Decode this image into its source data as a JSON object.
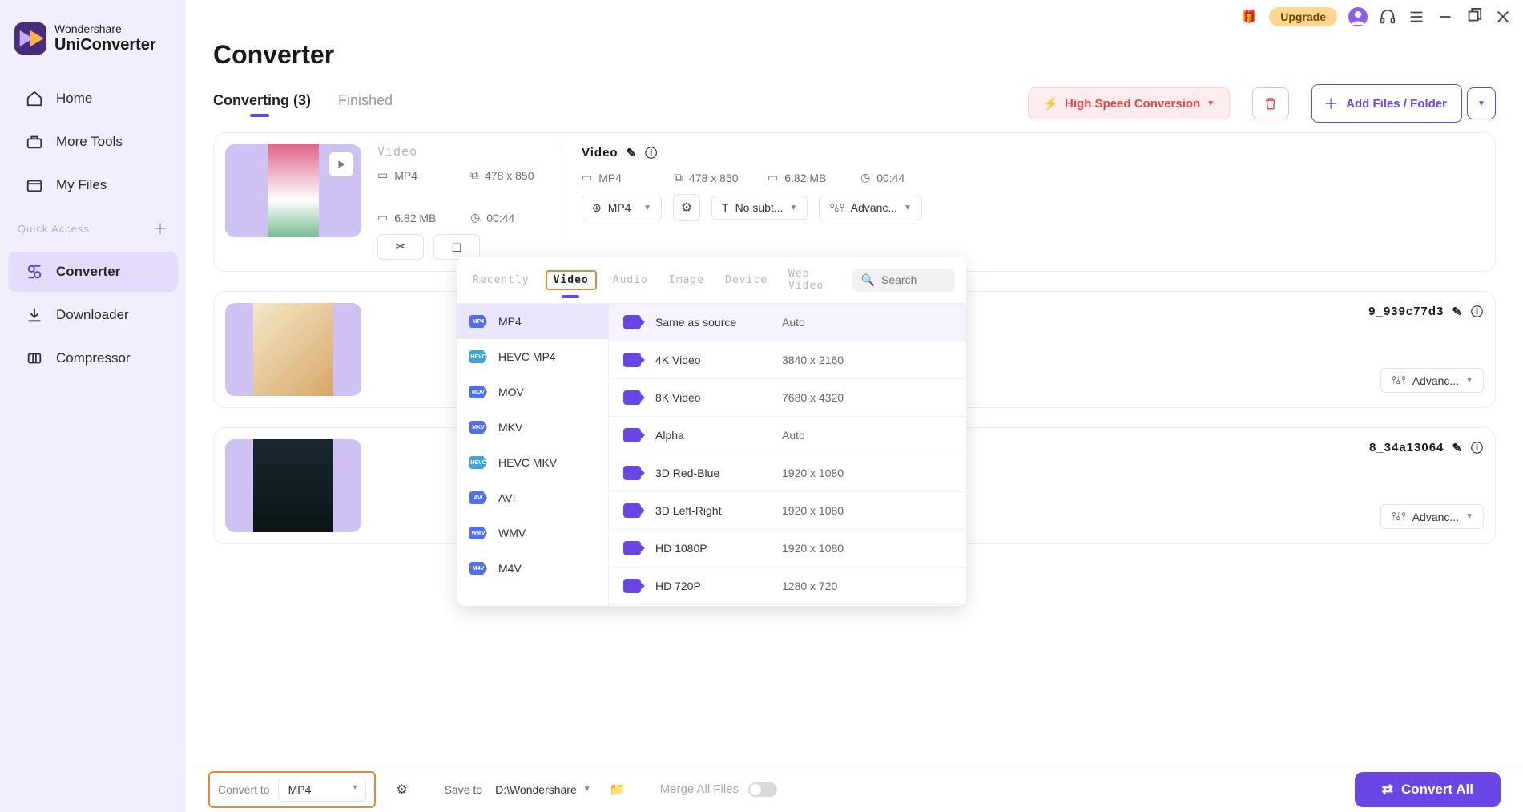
{
  "app": {
    "brand_top": "Wondershare",
    "brand_bottom": "UniConverter"
  },
  "sidebar": {
    "items": [
      {
        "label": "Home"
      },
      {
        "label": "More Tools"
      },
      {
        "label": "My Files"
      }
    ],
    "quick_access": "Quick Access",
    "items2": [
      {
        "label": "Converter"
      },
      {
        "label": "Downloader"
      },
      {
        "label": "Compressor"
      }
    ]
  },
  "titlebar": {
    "upgrade": "Upgrade"
  },
  "page": {
    "title": "Converter"
  },
  "tabs": {
    "converting": "Converting (3)",
    "finished": "Finished"
  },
  "toolbar": {
    "high_speed": "High Speed Conversion",
    "add_files": "Add Files / Folder"
  },
  "files": [
    {
      "src_label": "Video",
      "src": {
        "fmt": "MP4",
        "res": "478 x 850",
        "size": "6.82 MB",
        "dur": "00:44"
      },
      "out_name": "Video",
      "out": {
        "fmt": "MP4",
        "res": "478 x 850",
        "size": "6.82 MB",
        "dur": "00:44"
      },
      "fmt_select": "MP4",
      "subtitle": "No subt...",
      "advanced": "Advanc..."
    },
    {
      "out_name_tail": "9_939c77d3",
      "advanced": "Advanc..."
    },
    {
      "out_name_tail": "8_34a13064",
      "advanced": "Advanc..."
    }
  ],
  "popup": {
    "tabs": [
      "Recently",
      "Video",
      "Audio",
      "Image",
      "Device",
      "Web Video"
    ],
    "active_tab": "Video",
    "search_placeholder": "Search",
    "formats": [
      "MP4",
      "HEVC MP4",
      "MOV",
      "MKV",
      "HEVC MKV",
      "AVI",
      "WMV",
      "M4V"
    ],
    "resolutions": [
      {
        "name": "Same as source",
        "dim": "Auto"
      },
      {
        "name": "4K Video",
        "dim": "3840 x 2160"
      },
      {
        "name": "8K Video",
        "dim": "7680 x 4320"
      },
      {
        "name": "Alpha",
        "dim": "Auto"
      },
      {
        "name": "3D Red-Blue",
        "dim": "1920 x 1080"
      },
      {
        "name": "3D Left-Right",
        "dim": "1920 x 1080"
      },
      {
        "name": "HD 1080P",
        "dim": "1920 x 1080"
      },
      {
        "name": "HD 720P",
        "dim": "1280 x 720"
      }
    ]
  },
  "bottom": {
    "convert_to_label": "Convert to",
    "convert_to_value": "MP4",
    "save_to_label": "Save to",
    "save_to_value": "D:\\Wondershare",
    "merge": "Merge All Files",
    "convert_all": "Convert All"
  }
}
